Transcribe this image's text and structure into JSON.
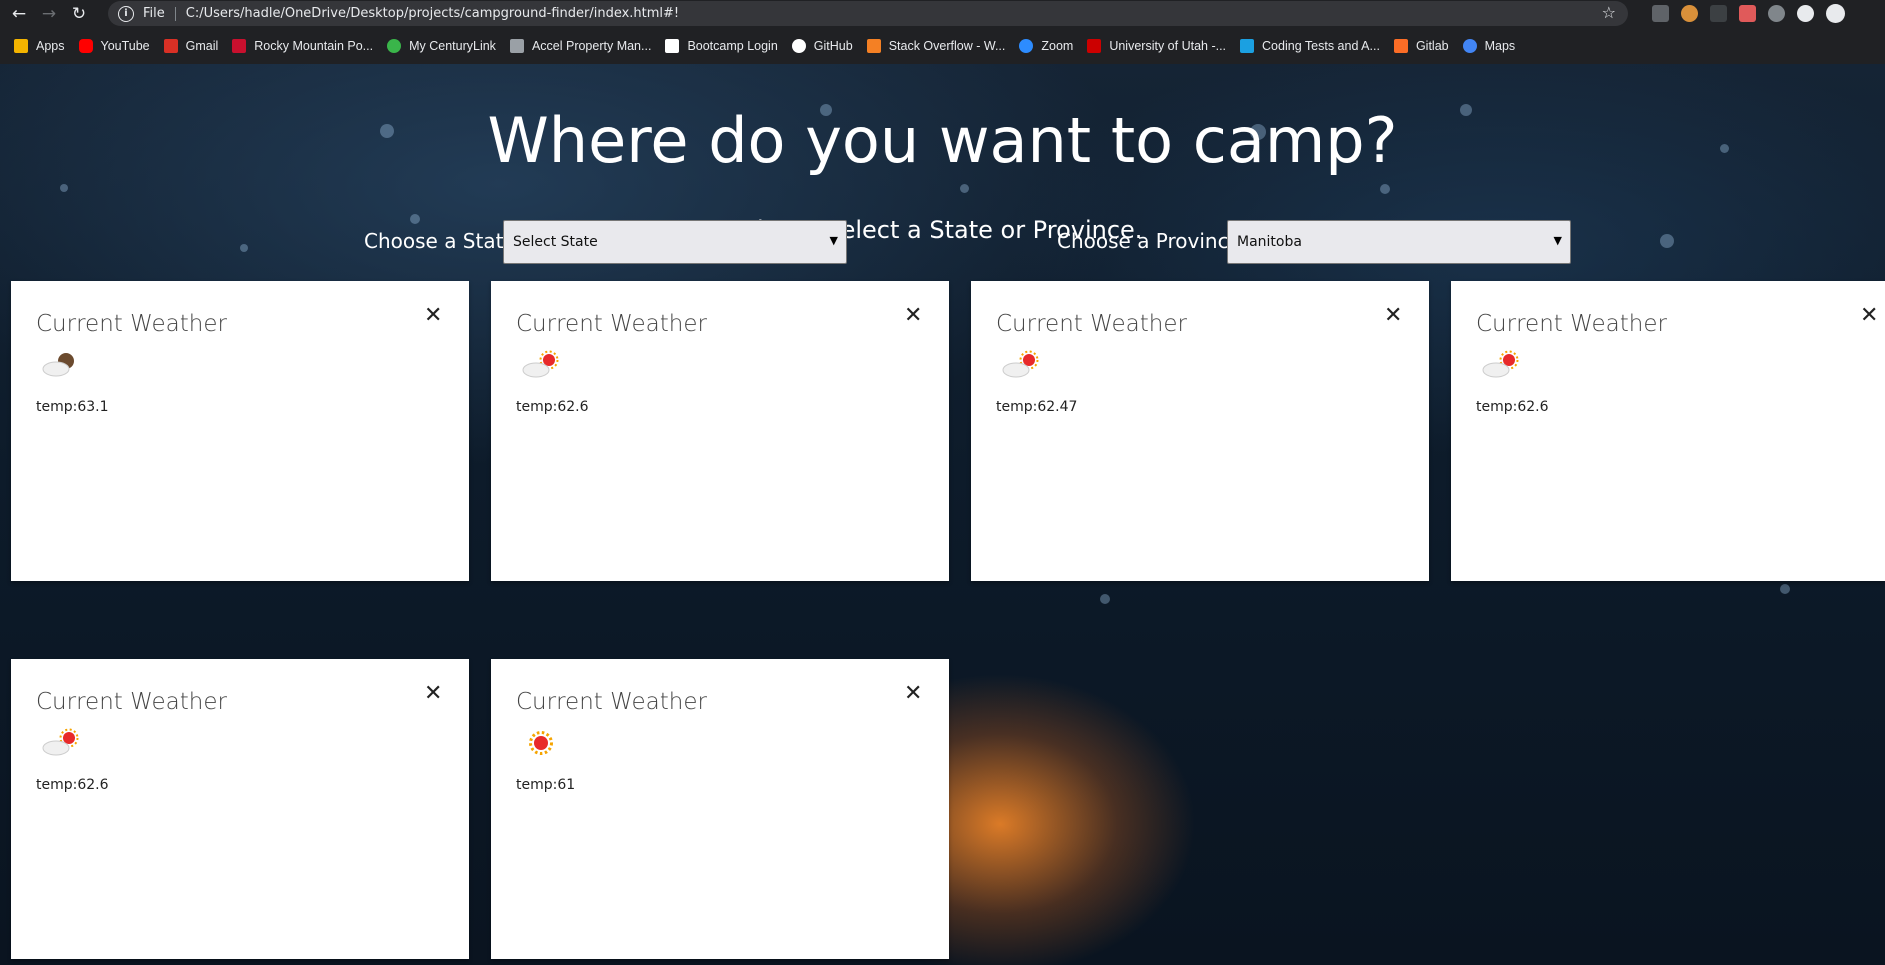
{
  "browser": {
    "url_scheme": "File",
    "url": "C:/Users/hadle/OneDrive/Desktop/projects/campground-finder/index.html#!",
    "bookmarks": [
      {
        "label": "Apps",
        "icon": "apps-grid-icon",
        "color": "#f4b400"
      },
      {
        "label": "YouTube",
        "icon": "youtube-icon",
        "color": "#ff0000"
      },
      {
        "label": "Gmail",
        "icon": "gmail-icon",
        "color": "#d93025"
      },
      {
        "label": "Rocky Mountain Po...",
        "icon": "rmp-icon",
        "color": "#c8102e"
      },
      {
        "label": "My CenturyLink",
        "icon": "centurylink-icon",
        "color": "#3ab54a"
      },
      {
        "label": "Accel Property Man...",
        "icon": "building-icon",
        "color": "#9aa0a6"
      },
      {
        "label": "Bootcamp Login",
        "icon": "utah-u-icon",
        "color": "#ffffff"
      },
      {
        "label": "GitHub",
        "icon": "github-icon",
        "color": "#ffffff"
      },
      {
        "label": "Stack Overflow - W...",
        "icon": "stackoverflow-icon",
        "color": "#f48024"
      },
      {
        "label": "Zoom",
        "icon": "zoom-icon",
        "color": "#2d8cff"
      },
      {
        "label": "University of Utah -...",
        "icon": "utah-u-icon",
        "color": "#cc0000"
      },
      {
        "label": "Coding Tests and A...",
        "icon": "coding-tests-icon",
        "color": "#1ba0e1"
      },
      {
        "label": "Gitlab",
        "icon": "gitlab-icon",
        "color": "#fc6d26"
      },
      {
        "label": "Maps",
        "icon": "maps-icon",
        "color": "#4285f4"
      }
    ]
  },
  "page": {
    "title": "Where do you want to camp?",
    "subtitle": "Please select a State or Province.",
    "state_label": "Choose a State:",
    "state_value": "Select State",
    "province_label": "Choose a Province:",
    "province_value": "Manitoba"
  },
  "cards": [
    {
      "title": "Current Weather",
      "close": "✕",
      "icon": "cloudy-night-icon",
      "temp": "temp:63.1"
    },
    {
      "title": "Current Weather",
      "close": "✕",
      "icon": "partly-sunny-icon",
      "temp": "temp:62.6"
    },
    {
      "title": "Current Weather",
      "close": "✕",
      "icon": "partly-sunny-icon",
      "temp": "temp:62.47"
    },
    {
      "title": "Current Weather",
      "close": "✕",
      "icon": "partly-sunny-icon",
      "temp": "temp:62.6"
    },
    {
      "title": "Current Weather",
      "close": "✕",
      "icon": "partly-sunny-icon",
      "temp": "temp:62.6"
    },
    {
      "title": "Current Weather",
      "close": "✕",
      "icon": "sunny-icon",
      "temp": "temp:61"
    }
  ]
}
